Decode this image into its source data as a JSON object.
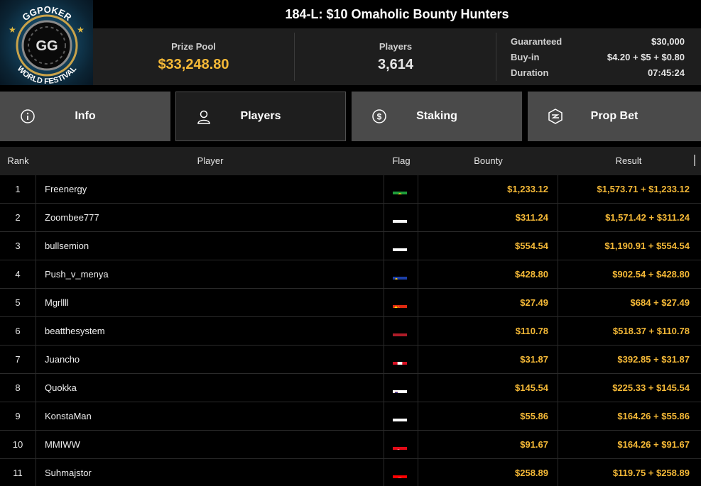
{
  "logo": {
    "top_text": "GGPOKER",
    "badge_text": "GG",
    "bottom_text": "WORLD FESTIVAL"
  },
  "header": {
    "title": "184-L: $10 Omaholic Bounty Hunters",
    "prize_pool_label": "Prize Pool",
    "prize_pool_value": "$33,248.80",
    "players_label": "Players",
    "players_value": "3,614",
    "details": [
      {
        "key": "Guaranteed",
        "value": "$30,000"
      },
      {
        "key": "Buy-in",
        "value": "$4.20 + $5 + $0.80"
      },
      {
        "key": "Duration",
        "value": "07:45:24"
      }
    ]
  },
  "tabs": [
    {
      "label": "Info",
      "icon": "info-icon",
      "active": false
    },
    {
      "label": "Players",
      "icon": "user-icon",
      "active": true
    },
    {
      "label": "Staking",
      "icon": "dollar-coin-icon",
      "active": false
    },
    {
      "label": "Prop Bet",
      "icon": "lightning-badge-icon",
      "active": false
    }
  ],
  "table": {
    "columns": [
      "Rank",
      "Player",
      "Flag",
      "Bounty",
      "Result"
    ],
    "rows": [
      {
        "rank": "1",
        "player": "Freenergy",
        "flag": "brazil-flag-icon",
        "bounty": "$1,233.12",
        "result": "$1,573.71 + $1,233.12"
      },
      {
        "rank": "2",
        "player": "Zoombee777",
        "flag": "cyprus-flag-icon",
        "bounty": "$311.24",
        "result": "$1,571.42 + $311.24"
      },
      {
        "rank": "3",
        "player": "bullsemion",
        "flag": "russia-flag-icon",
        "bounty": "$554.54",
        "result": "$1,190.91 + $554.54"
      },
      {
        "rank": "4",
        "player": "Push_v_menya",
        "flag": "liechtenstein-flag-icon",
        "bounty": "$428.80",
        "result": "$902.54 + $428.80"
      },
      {
        "rank": "5",
        "player": "Mgrllll",
        "flag": "china-flag-icon",
        "bounty": "$27.49",
        "result": "$684 + $27.49"
      },
      {
        "rank": "6",
        "player": "beatthesystem",
        "flag": "netherlands-flag-icon",
        "bounty": "$110.78",
        "result": "$518.37 + $110.78"
      },
      {
        "rank": "7",
        "player": "Juancho",
        "flag": "peru-flag-icon",
        "bounty": "$31.87",
        "result": "$392.85 + $31.87"
      },
      {
        "rank": "8",
        "player": "Quokka",
        "flag": "slovenia-flag-icon",
        "bounty": "$145.54",
        "result": "$225.33 + $145.54"
      },
      {
        "rank": "9",
        "player": "KonstaMan",
        "flag": "russia-flag-icon",
        "bounty": "$55.86",
        "result": "$164.26 + $55.86"
      },
      {
        "rank": "10",
        "player": "MMIWW",
        "flag": "turkey-flag-icon",
        "bounty": "$91.67",
        "result": "$164.26 + $91.67"
      },
      {
        "rank": "11",
        "player": "Suhmajstor",
        "flag": "croatia-flag-icon",
        "bounty": "$258.89",
        "result": "$119.75 + $258.89"
      }
    ]
  },
  "colors": {
    "accent_gold": "#f5b937",
    "tab_bg": "#4a4a4a",
    "header_bg": "#1e1e1e"
  }
}
